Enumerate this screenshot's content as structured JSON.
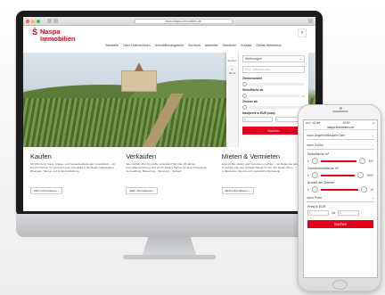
{
  "browser": {
    "url": "www.naspa-immobilien.de"
  },
  "site": {
    "logo_line1": "Naspa",
    "logo_line2": "Immobilien",
    "nav": [
      "Startseite",
      "Über Unternehmen",
      "Immobilienangebote",
      "Services",
      "Aktuelles",
      "Standorte",
      "Kontakt",
      "Online-Wertcheck"
    ]
  },
  "panel": {
    "tab_search": "Suchen",
    "tab_menu": "Menü",
    "type_select": "Wohnungen",
    "place_placeholder": "PLZ, Ortname etc.",
    "rooms_label": "Zimmeranzahl",
    "area_label": "Wohnfläche ab",
    "area_unit": "m²",
    "rooms2_label": "Zimmer ab",
    "price_label": "Kaufpreis in EUR (max)",
    "min": "0",
    "max": "0",
    "button": "Suchen"
  },
  "cards": [
    {
      "title": "Kaufen",
      "text": "Ob Wohnung, Haus, Anlage- und Gewerbeobjekt oder Grundstück – wir sind Ihr Partner für den Kauf einer Immobilie in der Region Wiesbaden, Rheingau, Taunus und Limburg-Weilburg.",
      "more": "Mehr Informationen ›"
    },
    {
      "title": "Verkaufen",
      "text": "Sie möchten Ihre Immobilie verkaufen? Mit über 25 Jahren Immobilienerfahrung sind wir Ihr starker Partner für eine erfolgreiche Vermarktung. Bewertung – Beratung – Verkauf.",
      "more": "Mehr Informationen ›"
    },
    {
      "title": "Mieten & Vermieten",
      "text": "Egal ob Sie mieten oder vermieten möchten – wir finden die passende Immobilie oder den richtigen Mieter für Sie. Wir bieten Ihnen umfassenden Service und persönliche Betreuung.",
      "more": "Mehr Informationen ›"
    }
  ],
  "phone": {
    "carrier": "••••○ o2-de",
    "time": "19:00",
    "url": "naspa-immobilien.de",
    "select1": "nach Angebot/Baujahr/Jahr",
    "select2": "nach Größe",
    "area_label": "Wohnfläche m²",
    "area_min": "0",
    "area_max": "300",
    "plot_label": "Grundstücksfläche m²",
    "plot_min": "0",
    "plot_max": "3500",
    "rooms_label": "Anzahl der Zimmer",
    "rooms_min": "0",
    "rooms_max": "15",
    "select3": "nach Preis",
    "price_label": "Preis in EUR",
    "price_from": "0",
    "price_to": "0",
    "button": "Suchen"
  }
}
